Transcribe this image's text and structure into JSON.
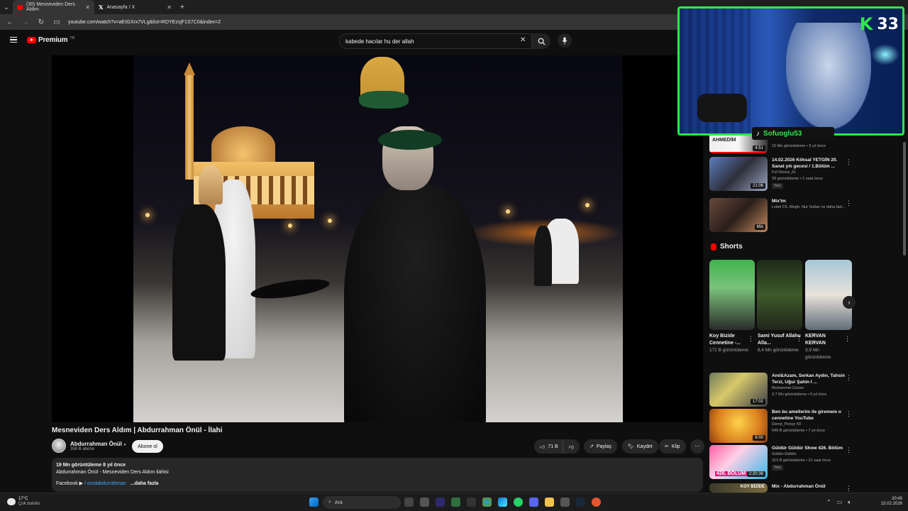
{
  "browser": {
    "tabs": [
      {
        "label": "(30) Mesneviden Ders Aldım",
        "active": true
      },
      {
        "label": "Anasayfa / X",
        "active": false
      }
    ],
    "url": "youtube.com/watch?v=aEIGXrx7VLg&list=RDYEzsjF1S7C0&index=2"
  },
  "header": {
    "logo_text": "Premium",
    "logo_region": "TR",
    "search_value": "kabede hacılar hu der allah"
  },
  "video": {
    "title": "Mesneviden Ders Aldım | Abdurrahman Önül - İlahi",
    "channel_name": "Abdurrahman Önül",
    "channel_subs": "359 B abone",
    "subscribe_label": "Abone ol",
    "likes": "71 B",
    "share_label": "Paylaş",
    "save_label": "Kaydet",
    "clip_label": "Klip",
    "description": {
      "meta": "19 Mn görüntüleme  8 yıl önce",
      "line1": "Abdurrahman Önül - Mesneviden Ders Aldım ilahisi",
      "line2": "Facebook ▶",
      "line2_link": "/ onulabdurrahman",
      "more_label": "...daha fazla"
    }
  },
  "sidebar": {
    "videos_top": [
      {
        "title": "",
        "channel": "15 Mn görüntüleme • 9 yıl önce",
        "meta": "",
        "duration": "4:51",
        "thumb_text": "GÜL AHMEDİM"
      },
      {
        "title": "14.02.2026 Köksal YETGİN 20. Sanat yılı gecesi / 1.Bölüm ...",
        "channel": "Fol Deresi_61",
        "meta": "39 görüntüleme • 1 saat önce",
        "duration": "21:06",
        "badge": "Yeni"
      },
      {
        "title": "Mix'im",
        "channel": "Lvbel C5, Wegh, Nur Sultan ve daha fazl...",
        "meta": "",
        "duration": "Mix"
      }
    ],
    "shorts_title": "Shorts",
    "shorts": [
      {
        "title": "Koy Bizide Cennetine -...",
        "views": "172 B görüntüleme"
      },
      {
        "title": "Sami Yusuf Allahu Alla...",
        "views": "8,4 Mn görüntüleme"
      },
      {
        "title": "KERVAN KERVAN",
        "views": "3,9 Mn görüntüleme"
      }
    ],
    "videos_bottom": [
      {
        "title": "Anıl&Azam, Serkan Aydın, Tahsin Terzi, Uğur Şahin I ...",
        "channel": "Muhammet Güven",
        "meta": "3,7 Mn görüntüleme • 6 yıl önce",
        "duration": "17:02"
      },
      {
        "title": "Ben bu amellerim ile giremem o cennetine   YouTube",
        "channel": "Demir_Pençe 43",
        "meta": "649 B görüntüleme • 7 yıl önce",
        "duration": "6:00"
      },
      {
        "title": "Güldür Güldür Show 426. Bölüm",
        "channel": "Güldür Güldür",
        "meta": "313 B görüntüleme • 21 saat önce",
        "duration": "2:20:38",
        "badge": "Yeni",
        "thumb_text": "426. BÖLÜM"
      },
      {
        "title": "Mix - Abdurrahman Önül",
        "channel": "",
        "meta": "",
        "duration": "",
        "thumb_text": "KOY BİZİDE"
      }
    ]
  },
  "overlay": {
    "counter": "33",
    "tiktok_handle": "Sofuoglu53"
  },
  "taskbar": {
    "weather_temp": "17°C",
    "weather_desc": "Çok bulutlu",
    "search_label": "Ara",
    "time": "20:45",
    "date": "15.02.2026"
  }
}
